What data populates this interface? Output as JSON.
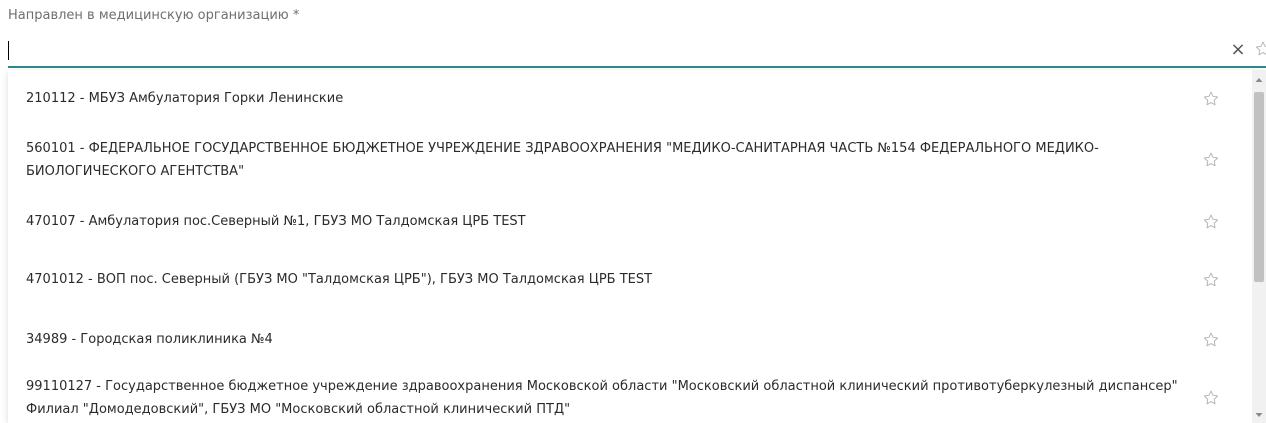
{
  "field": {
    "label": "Направлен в медицинскую организацию *",
    "value": "",
    "clear_symbol": "×"
  },
  "icons": {
    "clear": "close-icon",
    "favorite": "star-outline-icon",
    "scroll_up": "chevron-up-icon",
    "scroll_down": "chevron-down-icon"
  },
  "colors": {
    "underline": "#2a8a8f",
    "star": "#b5b5b5",
    "text": "#2b2b2b",
    "label": "#6f6f6f"
  },
  "options": [
    "210112 - МБУЗ Амбулатория Горки Ленинские",
    "560101 - ФЕДЕРАЛЬНОЕ ГОСУДАРСТВЕННОЕ БЮДЖЕТНОЕ УЧРЕЖДЕНИЕ ЗДРАВООХРАНЕНИЯ \"МЕДИКО-САНИТАРНАЯ ЧАСТЬ №154 ФЕДЕРАЛЬНОГО МЕДИКО-БИОЛОГИЧЕСКОГО АГЕНТСТВА\"",
    "470107 - Амбулатория пос.Северный №1, ГБУЗ МО Талдомская ЦРБ TEST",
    "4701012 - ВОП пос. Северный (ГБУЗ МО \"Талдомская ЦРБ\"), ГБУЗ МО Талдомская ЦРБ TEST",
    "34989 - Городская поликлиника №4",
    "99110127 - Государственное бюджетное учреждение здравоохранения Московской области \"Московский областной клинический противотуберкулезный диспансер\" Филиал \"Домодедовский\", ГБУЗ МО \"Московский областной клинический ПТД\""
  ]
}
